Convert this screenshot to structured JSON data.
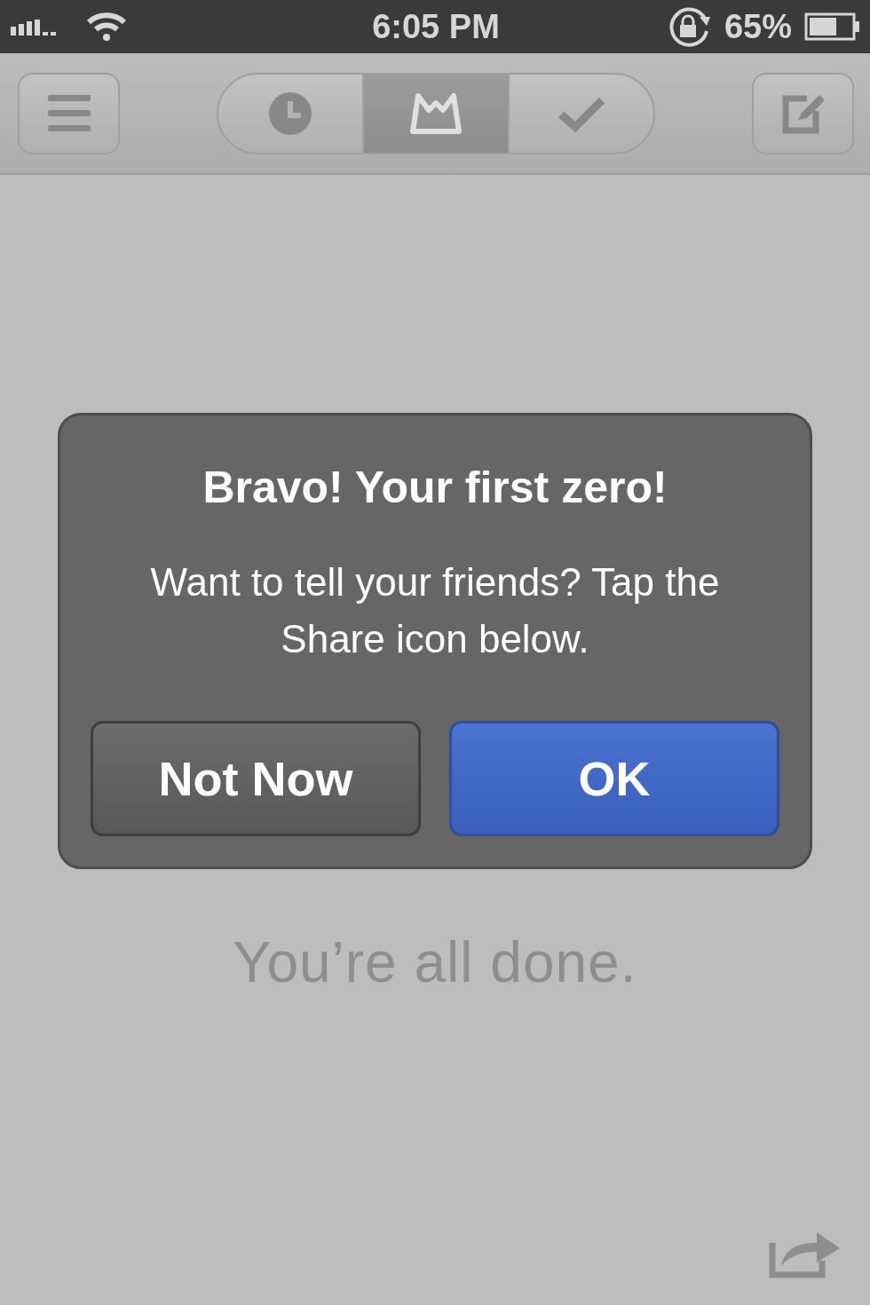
{
  "status_bar": {
    "time": "6:05 PM",
    "battery": "65%"
  },
  "toolbar": {
    "tabs": [
      {
        "kind": "recent",
        "selected": false
      },
      {
        "kind": "inbox",
        "selected": true
      },
      {
        "kind": "done",
        "selected": false
      }
    ]
  },
  "alert": {
    "title": "Bravo! Your first zero!",
    "message": "Want to tell your friends? Tap the Share icon below.",
    "buttons": [
      {
        "label": "Not Now",
        "kind": "cancel"
      },
      {
        "label": "OK",
        "kind": "default"
      }
    ]
  },
  "empty_message": "You’re all done."
}
